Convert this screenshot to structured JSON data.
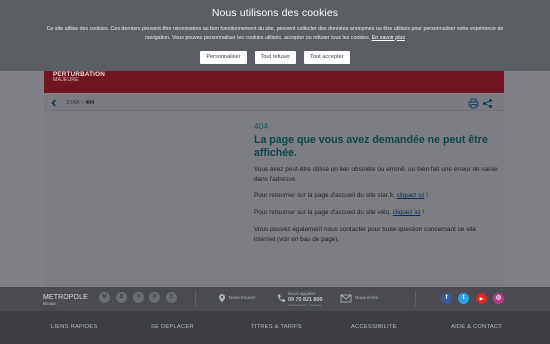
{
  "cookie_banner": {
    "title": "Nous utilisons des cookies",
    "text": "Ce site utilise des cookies. Ces derniers peuvent être nécessaires au bon fonctionnement du site, peuvent collecter des données anonymes ou être utilisés pour personnaliser votre expérience de navigation. Vous pouvez personnaliser les cookies utilisés, accepter ou refuser tous les cookies.",
    "link": "En savoir plus",
    "buttons": [
      "Personnaliser",
      "Tout refuser",
      "Tout accepter"
    ]
  },
  "alert": {
    "title": "PERTURBATION",
    "subtitle": "MAJEURE"
  },
  "breadcrumb": {
    "root": "STAR",
    "separator": "/",
    "current": "404"
  },
  "error": {
    "code": "404",
    "title": "La page que vous avez demandée ne peut être affichée.",
    "p1": "Vous avez peut-être utilisé un lien obsolète ou erroné, ou bien fait une erreur de saisie dans l'adresse.",
    "p2_prefix": "Pour retourner sur la page d'accueil du site star.fr,",
    "p2_link": "cliquez ici",
    "p2_suffix": "!",
    "p3_prefix": "Pour retourner sur la page d'accueil du site vélo,",
    "p3_link": "cliquez ici",
    "p3_suffix": "!",
    "p4": "Vous pouvez également nous contacter pour toute question concernant ce site internet (voir en bas de page)."
  },
  "footer": {
    "logo_text": "METROPOLE",
    "logo_sub": "RENNES",
    "transport_icons": [
      "metro-icon",
      "bus-icon",
      "velo-icon",
      "parking-icon",
      "car-icon"
    ],
    "transport_letters": [
      "M",
      "B",
      "V",
      "P",
      "C"
    ],
    "find_us": "Nous trouver",
    "call_label": "Nous appeler",
    "phone": "09 70 821 800",
    "phone_note": "service gratuit + prix appel",
    "write_us": "Nous écrire",
    "social": [
      {
        "icon": "facebook-icon",
        "letter": "f",
        "color": "#3b5998"
      },
      {
        "icon": "twitter-icon",
        "letter": "t",
        "color": "#2aa3e0"
      },
      {
        "icon": "youtube-icon",
        "letter": "▶",
        "color": "#d42b25"
      },
      {
        "icon": "instagram-icon",
        "letter": "◎",
        "color": "#b83c8a"
      }
    ],
    "nav": [
      "LIENS RAPIDES",
      "SE DEPLACER",
      "TITRES & TARIFS",
      "ACCESSIBILITE",
      "AIDE & CONTACT"
    ]
  },
  "colors": {
    "overlay": "#808186",
    "banner": "#5a5d62",
    "alert": "#6f1420",
    "teal": "#0e4548"
  }
}
